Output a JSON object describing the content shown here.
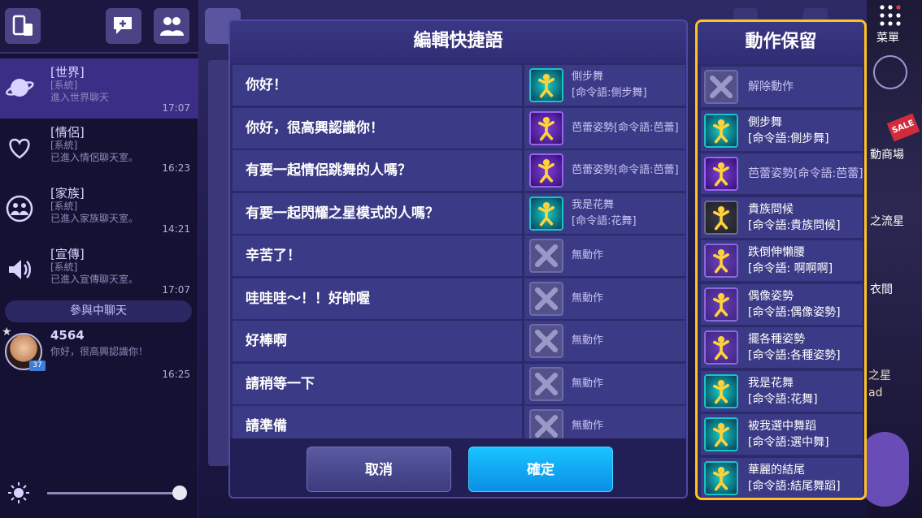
{
  "left_panel": {
    "channels": [
      {
        "name": "[世界]",
        "sub": "[系統]\n進入世界聊天",
        "time": "17:07"
      },
      {
        "name": "[情侶]",
        "sub": "[系統]\n已進入情侶聊天室。",
        "time": "16:23"
      },
      {
        "name": "[家族]",
        "sub": "[系統]\n已進入家族聊天室。",
        "time": "14:21"
      },
      {
        "name": "[宣傳]",
        "sub": "[系統]\n已進入宣傳聊天室。",
        "time": "17:07"
      }
    ],
    "joined_header": "參與中聊天",
    "joined_chat": {
      "name": "4564",
      "message": "你好，很高興認識你！",
      "time": "16:25",
      "level": "37"
    }
  },
  "modal": {
    "title": "編輯快捷語",
    "rows": [
      {
        "phrase": "你好！",
        "action": "側步舞\n[命令語:側步舞]",
        "thumb": "dance",
        "two_line": true
      },
      {
        "phrase": "你好，很高興認識你！",
        "action": "芭蕾姿勢[命令語:芭蕾]",
        "thumb": "ballet",
        "two_line": false
      },
      {
        "phrase": "有要一起情侶跳舞的人嗎？",
        "action": "芭蕾姿勢[命令語:芭蕾]",
        "thumb": "ballet",
        "two_line": false
      },
      {
        "phrase": "有要一起閃耀之星模式的人嗎？",
        "action": "我是花舞\n[命令語:花舞]",
        "thumb": "dance",
        "two_line": true
      },
      {
        "phrase": "辛苦了！",
        "action": "無動作",
        "thumb": "none",
        "two_line": false
      },
      {
        "phrase": "哇哇哇～！！好帥喔",
        "action": "無動作",
        "thumb": "none",
        "two_line": false
      },
      {
        "phrase": "好棒啊",
        "action": "無動作",
        "thumb": "none",
        "two_line": false
      },
      {
        "phrase": "請稍等一下",
        "action": "無動作",
        "thumb": "none",
        "two_line": false
      },
      {
        "phrase": "請準備",
        "action": "無動作",
        "thumb": "none",
        "two_line": false
      }
    ],
    "cancel_label": "取消",
    "confirm_label": "確定"
  },
  "keep_panel": {
    "title": "動作保留",
    "items": [
      {
        "label": "解除動作",
        "thumb": "none",
        "two_line": false
      },
      {
        "label": "側步舞\n[命令語:側步舞]",
        "thumb": "dance",
        "two_line": true
      },
      {
        "label": "芭蕾姿勢[命令語:芭蕾]",
        "thumb": "ballet",
        "two_line": false
      },
      {
        "label": "貴族問候\n[命令語:貴族問候]",
        "thumb": "dark",
        "two_line": true
      },
      {
        "label": "跌倒伸懶腰\n[命令語: 啊啊啊]",
        "thumb": "gold",
        "two_line": true
      },
      {
        "label": "偶像姿勢\n[命令語:偶像姿勢]",
        "thumb": "gold",
        "two_line": true
      },
      {
        "label": "擺各種姿勢\n[命令語:各種姿勢]",
        "thumb": "gold",
        "two_line": true
      },
      {
        "label": "我是花舞\n[命令語:花舞]",
        "thumb": "dance",
        "two_line": true
      },
      {
        "label": "被我選中舞蹈\n[命令語:選中舞]",
        "thumb": "dance",
        "two_line": true
      },
      {
        "label": "華麗的結尾\n[命令語:結尾舞蹈]",
        "thumb": "dance",
        "two_line": true
      }
    ]
  },
  "background": {
    "menu_label": "菜單",
    "shop_label": "動商場",
    "star_label": "之流星",
    "closet_label": "衣間",
    "sale_label": "SALE",
    "side_text_1": "之星",
    "side_text_2": "ad"
  },
  "colors": {
    "highlight_border": "#ffc21f",
    "confirm_button": "#0b8ee6",
    "panel_bg": "#2c2a6a",
    "row_bg": "#3b3a86"
  }
}
